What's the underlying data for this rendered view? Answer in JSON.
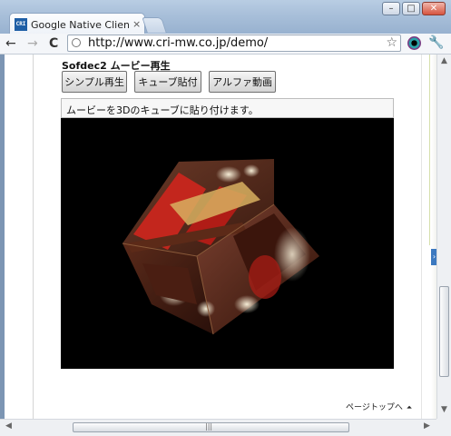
{
  "browser": {
    "tab_title": "Google Native Clientデモ",
    "tab_close": "×",
    "url": "http://www.cri-mw.co.jp/demo/",
    "back_icon": "arrow-left-icon",
    "forward_icon": "arrow-right-icon",
    "reload_icon": "reload-icon",
    "back_glyph": "←",
    "forward_glyph": "→",
    "reload_glyph": "C",
    "star_glyph": "☆",
    "wrench_glyph": "🔧",
    "favicon_text": "CRI"
  },
  "window_controls": {
    "minimize": "–",
    "maximize": "□",
    "close": "✕"
  },
  "page": {
    "section_title": "Sofdec2 ムービー再生",
    "buttons": [
      "シンプル再生",
      "キューブ貼付",
      "アルファ動画"
    ],
    "description": "ムービーを3Dのキューブに貼り付けます。",
    "page_top_link": "ページトップへ",
    "page_top_icon": "double-chevron-up-icon"
  },
  "scrollbar": {
    "grip": "|||"
  },
  "colors": {
    "frame": "#a9c0da",
    "movie_background": "#000000",
    "cube_dark": "#4a1e12",
    "cube_red": "#c0201a",
    "cube_gold": "#d8b060"
  }
}
